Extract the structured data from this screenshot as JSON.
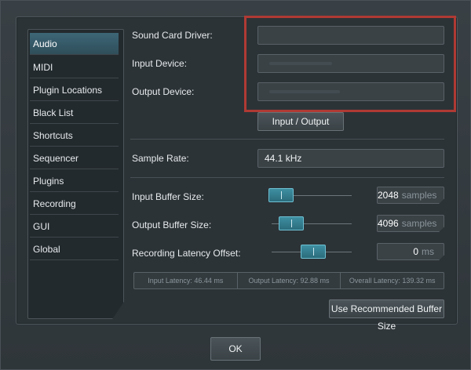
{
  "sidebar": {
    "items": [
      {
        "label": "Audio",
        "active": true
      },
      {
        "label": "MIDI",
        "active": false
      },
      {
        "label": "Plugin Locations",
        "active": false
      },
      {
        "label": "Black List",
        "active": false
      },
      {
        "label": "Shortcuts",
        "active": false
      },
      {
        "label": "Sequencer",
        "active": false
      },
      {
        "label": "Plugins",
        "active": false
      },
      {
        "label": "Recording",
        "active": false
      },
      {
        "label": "GUI",
        "active": false
      },
      {
        "label": "Global",
        "active": false
      }
    ]
  },
  "audio": {
    "sound_card_driver_label": "Sound Card Driver:",
    "sound_card_driver_value": "",
    "input_device_label": "Input Device:",
    "input_device_value": "",
    "output_device_label": "Output Device:",
    "output_device_value": "",
    "input_output_button": "Input / Output",
    "sample_rate_label": "Sample Rate:",
    "sample_rate_value": "44.1 kHz",
    "input_buffer_label": "Input Buffer Size:",
    "input_buffer_value": "2048",
    "input_buffer_unit": "samples",
    "output_buffer_label": "Output Buffer Size:",
    "output_buffer_value": "4096",
    "output_buffer_unit": "samples",
    "latency_offset_label": "Recording Latency Offset:",
    "latency_offset_value": "0",
    "latency_offset_unit": "ms",
    "input_latency": "Input Latency: 46.44 ms",
    "output_latency": "Output Latency: 92.88 ms",
    "overall_latency": "Overall Latency: 139.32 ms",
    "recommended_button": "Use Recommended Buffer Size"
  },
  "dialog": {
    "ok_label": "OK"
  },
  "colors": {
    "accent": "#3e8fa2",
    "highlight": "#b03a34"
  }
}
